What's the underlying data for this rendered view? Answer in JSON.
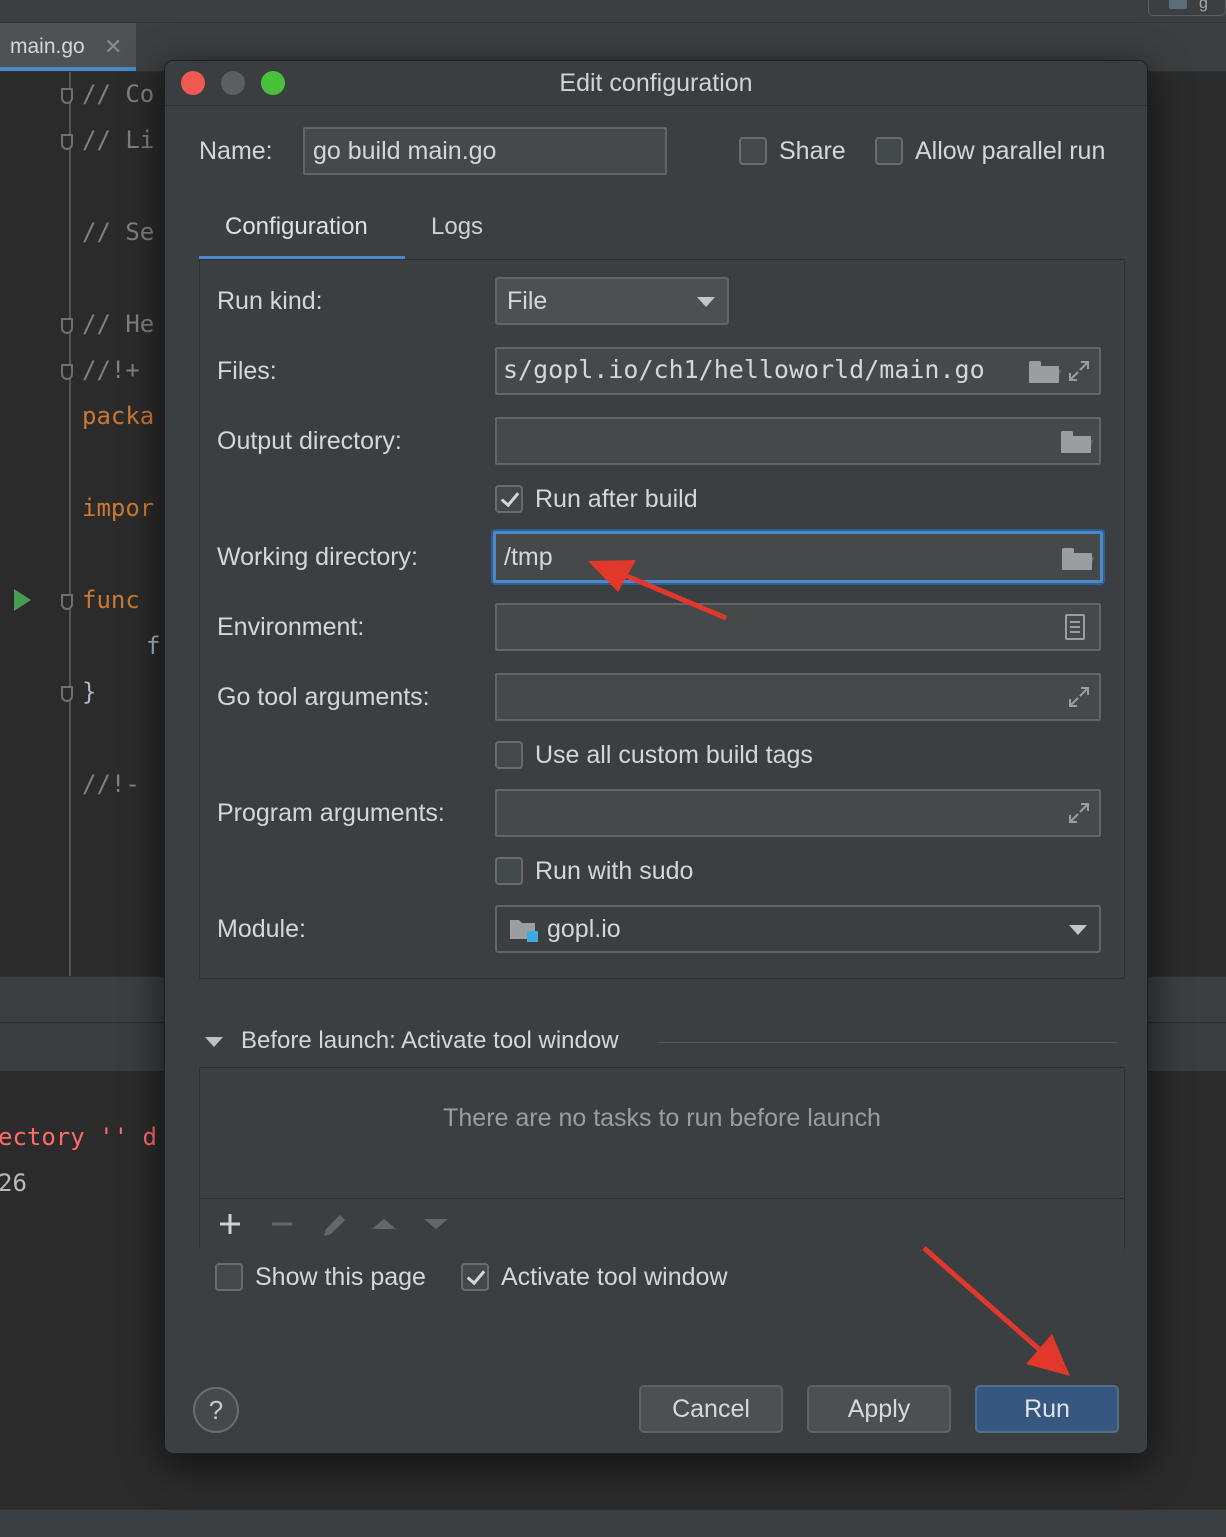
{
  "ide": {
    "tab_label": "main.go",
    "tab_close": "✕",
    "corner_label": "g",
    "code_lines": [
      {
        "text": "// Co",
        "kind": "comment"
      },
      {
        "text": "// Li",
        "kind": "comment"
      },
      {
        "text": "// Se",
        "kind": "comment"
      },
      {
        "text": "// He",
        "kind": "comment"
      },
      {
        "text": "//!+",
        "kind": "comment"
      },
      {
        "text": "packa",
        "kind": "keyword"
      },
      {
        "text": "impor",
        "kind": "keyword"
      },
      {
        "text": "func",
        "kind": "keyword"
      },
      {
        "text": "f",
        "kind": "plain"
      },
      {
        "text": "}",
        "kind": "plain"
      },
      {
        "text": "//!-",
        "kind": "comment"
      }
    ],
    "console_lines": [
      "ectory '' d",
      "26"
    ]
  },
  "dialog": {
    "title": "Edit configuration",
    "name_label": "Name:",
    "name_value": "go build main.go",
    "share_label": "Share",
    "share_checked": false,
    "parallel_label": "Allow parallel run",
    "parallel_checked": false,
    "tabs": [
      {
        "label": "Configuration",
        "selected": true
      },
      {
        "label": "Logs",
        "selected": false
      }
    ],
    "form": {
      "run_kind_label": "Run kind:",
      "run_kind_value": "File",
      "files_label": "Files:",
      "files_value": "s/gopl.io/ch1/helloworld/main.go",
      "output_dir_label": "Output directory:",
      "output_dir_value": "",
      "run_after_build_label": "Run after build",
      "run_after_build_checked": true,
      "working_dir_label": "Working directory:",
      "working_dir_value": "/tmp",
      "environment_label": "Environment:",
      "environment_value": "",
      "go_tool_args_label": "Go tool arguments:",
      "go_tool_args_value": "",
      "custom_tags_label": "Use all custom build tags",
      "custom_tags_checked": false,
      "program_args_label": "Program arguments:",
      "program_args_value": "",
      "sudo_label": "Run with sudo",
      "sudo_checked": false,
      "module_label": "Module:",
      "module_value": "gopl.io"
    },
    "before_launch": {
      "header": "Before launch: Activate tool window",
      "empty_text": "There are no tasks to run before launch",
      "toolbar": [
        "add-icon",
        "remove-icon",
        "edit-icon",
        "move-up-icon",
        "move-down-icon"
      ]
    },
    "show_page_label": "Show this page",
    "show_page_checked": false,
    "activate_window_label": "Activate tool window",
    "activate_window_checked": true,
    "buttons": {
      "help": "?",
      "cancel": "Cancel",
      "apply": "Apply",
      "run": "Run"
    }
  },
  "colors": {
    "accent": "#4a88c7",
    "primary_button": "#365880",
    "annotation_arrow": "#e0392b",
    "traffic_close": "#ee5a52",
    "traffic_max": "#4ac13b"
  }
}
